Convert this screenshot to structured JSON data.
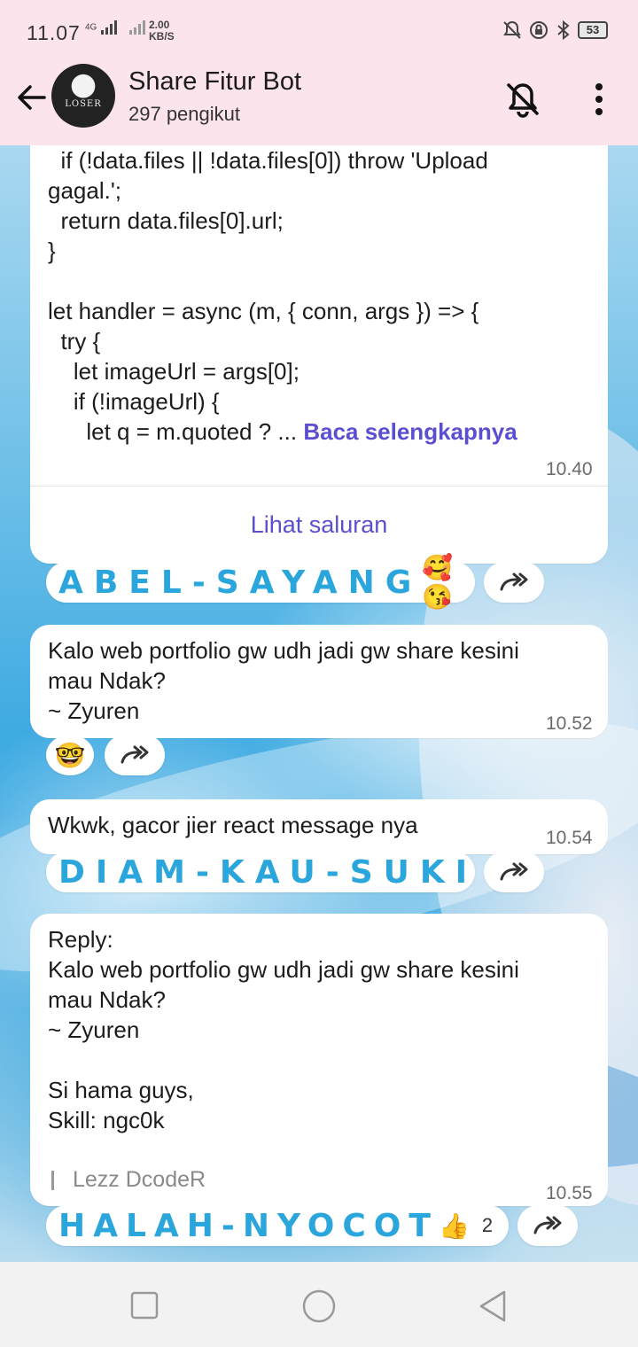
{
  "status_bar": {
    "time": "11.07",
    "network_label": "4G",
    "speed_value": "2.00",
    "speed_unit": "KB/S",
    "battery": "53"
  },
  "header": {
    "channel_name": "Share Fitur Bot",
    "followers": "297 pengikut",
    "avatar_text": "LOSER"
  },
  "messages": [
    {
      "lines": [
        "  if (!data.files || !data.files[0]) throw 'Upload",
        "gagal.';",
        "  return data.files[0].url;",
        "}",
        "",
        "let handler = async (m, { conn, args }) => {",
        "  try {",
        "    let imageUrl = args[0];",
        "    if (!imageUrl) {",
        "      let q = m.quoted ? ... "
      ],
      "read_more": "Baca selengkapnya",
      "time": "10.40",
      "view_channel": "Lihat saluran",
      "reaction_text": "ABEL-SAYANG",
      "reaction_emoji": "🥰😘"
    },
    {
      "lines": [
        "Kalo web portfolio gw udh jadi gw share kesini",
        "mau Ndak?",
        "~ Zyuren"
      ],
      "time": "10.52",
      "reaction_emoji": "🤓"
    },
    {
      "lines": [
        "Wkwk, gacor jier react message nya"
      ],
      "time": "10.54",
      "reaction_text": "DIAM-KAU-SUKI"
    },
    {
      "lines": [
        "Reply:",
        "Kalo web portfolio gw udh jadi gw share kesini",
        "mau Ndak?",
        "~ Zyuren",
        "",
        "Si hama guys,",
        "Skill: ngc0k"
      ],
      "signature": "Lezz DcodeR",
      "time": "10.55",
      "reaction_text": "HALAH-NYOCOT",
      "reaction_emoji": "👍",
      "reaction_count": "2"
    }
  ],
  "icons": {
    "back": "arrow-left-icon",
    "mute": "bell-off-icon",
    "menu": "more-vert-icon",
    "forward": "forward-icon",
    "nav_recent": "square-icon",
    "nav_home": "circle-icon",
    "nav_back": "triangle-icon"
  },
  "colors": {
    "header_bg": "#fce4ec",
    "accent": "#5b4fd1",
    "reaction_text": "#2aa6dc"
  }
}
